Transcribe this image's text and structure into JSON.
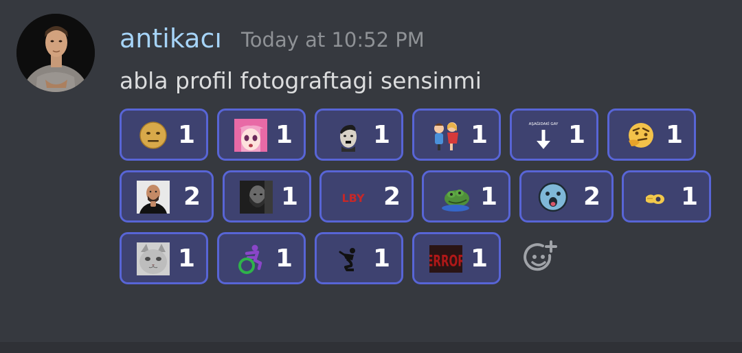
{
  "message": {
    "username": "antikacı",
    "timestamp": "Today at 10:52 PM",
    "content": "abla profil fotograftagi sensinmi"
  },
  "colors": {
    "background": "#36393f",
    "username": "#a6d4f8",
    "timestamp": "#8f9296",
    "text": "#dcddde",
    "reaction_border": "#5865d6",
    "reaction_bg": "#3e4270"
  },
  "reactions": [
    {
      "emoji": "neutral-face-emoji",
      "count": "1"
    },
    {
      "emoji": "anime-girl-emoji",
      "count": "1"
    },
    {
      "emoji": "mustache-face-emoji",
      "count": "1"
    },
    {
      "emoji": "couple-emoji",
      "count": "1"
    },
    {
      "emoji": "arrow-down-emoji",
      "label": "AŞAĞIDAKİ GAY",
      "count": "1"
    },
    {
      "emoji": "thinking-face-emoji",
      "count": "1"
    },
    {
      "emoji": "bald-man-emoji",
      "count": "2"
    },
    {
      "emoji": "dark-portrait-emoji",
      "count": "1"
    },
    {
      "emoji": "lby-text-emoji",
      "label": "LBY",
      "count": "2"
    },
    {
      "emoji": "frog-emoji",
      "count": "1"
    },
    {
      "emoji": "surprised-blob-emoji",
      "count": "2"
    },
    {
      "emoji": "pointing-hand-emoji",
      "count": "1"
    },
    {
      "emoji": "cat-emoji",
      "count": "1"
    },
    {
      "emoji": "wheelchair-emoji",
      "count": "1"
    },
    {
      "emoji": "figure-emoji",
      "count": "1"
    },
    {
      "emoji": "error-text-emoji",
      "label": "ERROR",
      "count": "1"
    }
  ],
  "add_reaction": {
    "icon": "add-reaction-icon"
  }
}
